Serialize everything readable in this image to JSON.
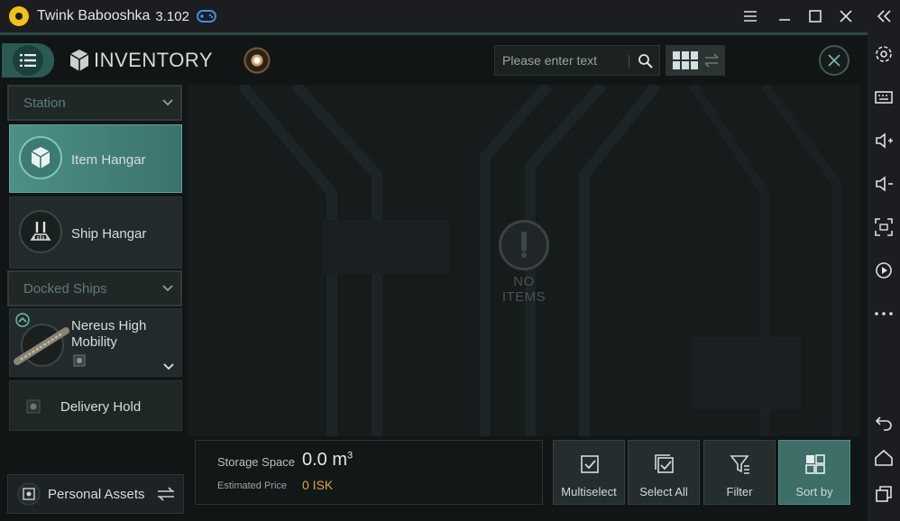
{
  "window": {
    "app_title": "Twink Babooshka",
    "app_version": "3.102"
  },
  "header": {
    "title": "INVENTORY",
    "search_placeholder": "Please enter text"
  },
  "sidebar": {
    "station_label": "Station",
    "items": [
      {
        "label": "Item Hangar",
        "active": true
      },
      {
        "label": "Ship Hangar",
        "active": false
      }
    ],
    "docked_label": "Docked Ships",
    "ship": {
      "name": "Nereus High Mobility"
    },
    "delivery_label": "Delivery Hold",
    "personal_assets_label": "Personal Assets"
  },
  "main": {
    "empty_text": "NO ITEMS"
  },
  "storage": {
    "space_label": "Storage Space",
    "space_value": "0.0 m",
    "space_unit_sup": "3",
    "price_label": "Estimated Price",
    "price_value": "0 ISK"
  },
  "actions": [
    {
      "label": "Multiselect",
      "icon": "multiselect-icon"
    },
    {
      "label": "Select All",
      "icon": "select-all-icon"
    },
    {
      "label": "Filter",
      "icon": "filter-icon"
    },
    {
      "label": "Sort by",
      "icon": "sort-icon"
    }
  ],
  "colors": {
    "accent": "#3d6e67",
    "price": "#e0a33a",
    "logo": "#f3c019"
  }
}
